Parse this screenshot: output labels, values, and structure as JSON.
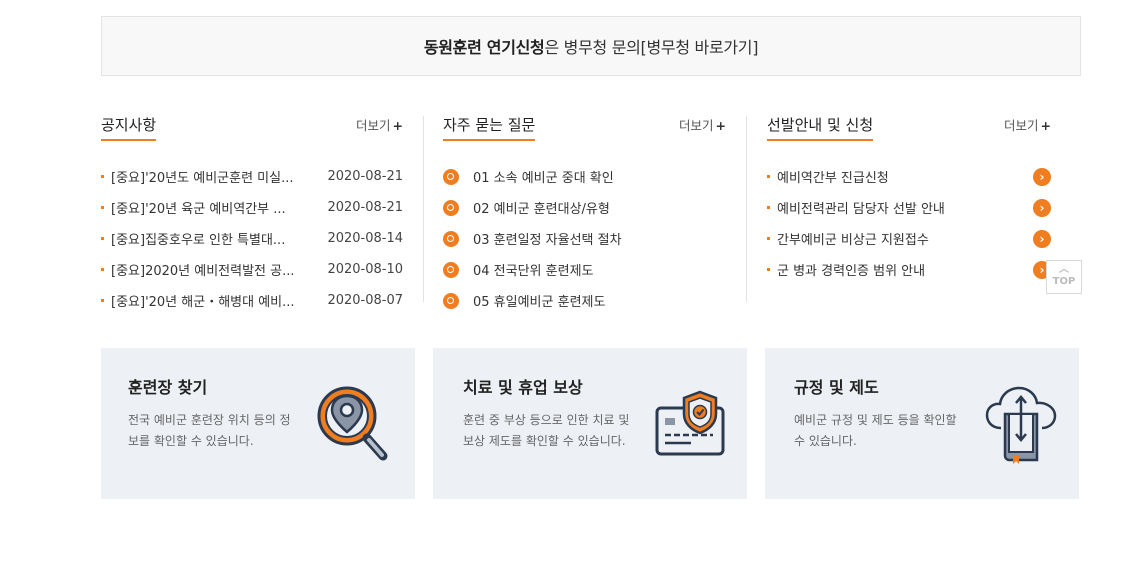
{
  "banner": {
    "strong": "동원훈련 연기신청",
    "rest": "은 병무청 문의[병무청 바로가기]"
  },
  "notice": {
    "title": "공지사항",
    "more": "더보기",
    "items": [
      {
        "text": "[중요]'20년도 예비군훈련 미실...",
        "date": "2020-08-21"
      },
      {
        "text": "[중요]'20년 육군 예비역간부 ...",
        "date": "2020-08-21"
      },
      {
        "text": "[중요]집중호우로 인한 특별대...",
        "date": "2020-08-14"
      },
      {
        "text": "[중요]2020년 예비전력발전 공...",
        "date": "2020-08-10"
      },
      {
        "text": "[중요]'20년 해군・해병대 예비...",
        "date": "2020-08-07"
      }
    ]
  },
  "faq": {
    "title": "자주 묻는 질문",
    "more": "더보기",
    "items": [
      "01 소속 예비군 중대 확인",
      "02 예비군 훈련대상/유형",
      "03 훈련일정 자율선택 절차",
      "04 전국단위 훈련제도",
      "05 휴일예비군 훈련제도"
    ]
  },
  "selection": {
    "title": "선발안내 및 신청",
    "more": "더보기",
    "items": [
      "예비역간부 진급신청",
      "예비전력관리 담당자 선발 안내",
      "간부예비군 비상근 지원접수",
      "군 병과 경력인증 범위 안내"
    ]
  },
  "top_button": "TOP",
  "cards": [
    {
      "title": "훈련장 찾기",
      "desc": "전국 예비군 훈련장 위치 등의 정보를 확인할 수 있습니다."
    },
    {
      "title": "치료 및 휴업 보상",
      "desc": "훈련 중 부상 등으로 인한 치료 및 보상 제도를 확인할 수 있습니다."
    },
    {
      "title": "규정 및 제도",
      "desc": "예비군 규정 및 제도 등을 확인할 수 있습니다."
    }
  ],
  "colors": {
    "accent": "#f07d20",
    "navy": "#2b3a4f",
    "card_bg": "#edf0f5"
  }
}
